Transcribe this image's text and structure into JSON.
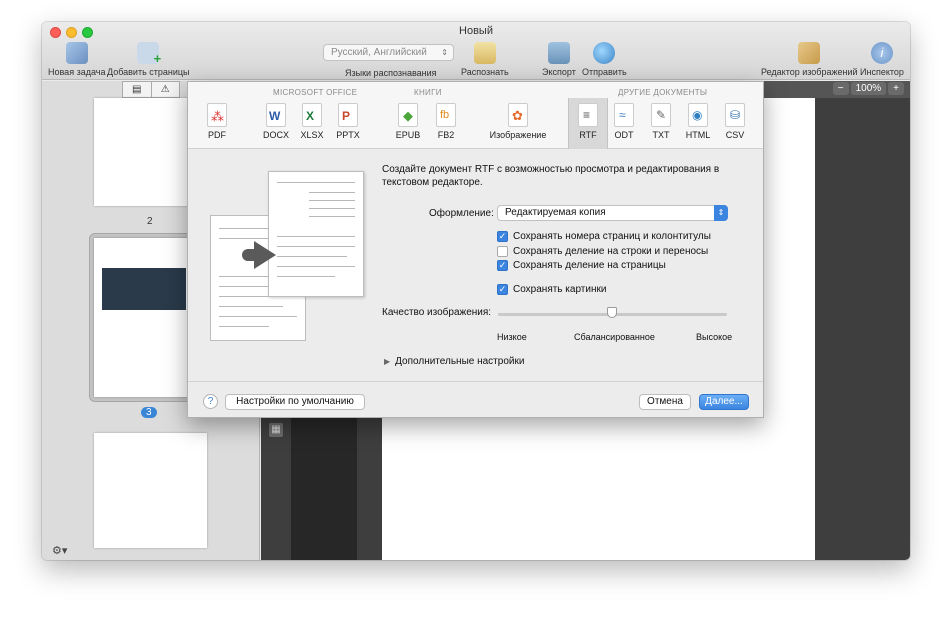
{
  "window": {
    "title": "Новый"
  },
  "toolbar": {
    "new_task": "Новая задача",
    "add_pages": "Добавить страницы",
    "languages_value": "Русский, Английский",
    "languages_caption": "Языки распознавания",
    "recognize": "Распознать",
    "export": "Экспорт",
    "send": "Отправить",
    "image_editor": "Редактор изображений",
    "inspector": "Инспектор"
  },
  "sidebar": {
    "pages": [
      {
        "number": "2"
      },
      {
        "number": "3",
        "selected": true
      }
    ]
  },
  "canvas": {
    "zoom": "100%",
    "zoom_out": "−",
    "zoom_in": "+"
  },
  "export_dialog": {
    "groups": {
      "office": "MICROSOFT OFFICE",
      "books": "КНИГИ",
      "other": "ДРУГИЕ ДОКУМЕНТЫ"
    },
    "formats": [
      "PDF",
      "DOCX",
      "XLSX",
      "PPTX",
      "EPUB",
      "FB2",
      "Изображение",
      "RTF",
      "ODT",
      "TXT",
      "HTML",
      "CSV"
    ],
    "selected_format": "RTF",
    "description": "Создайте документ RTF с возможностью просмотра и редактирования в текстовом редакторе.",
    "layout_label": "Оформление:",
    "layout_value": "Редактируемая копия",
    "options": [
      {
        "label": "Сохранять номера страниц и колонтитулы",
        "checked": true
      },
      {
        "label": "Сохранять деление на строки и переносы",
        "checked": false
      },
      {
        "label": "Сохранять деление на страницы",
        "checked": true
      },
      {
        "label": "Сохранять картинки",
        "checked": true
      }
    ],
    "quality_label": "Качество изображения:",
    "quality_levels": [
      "Низкое",
      "Сбалансированное",
      "Высокое"
    ],
    "quality_value": 0.5,
    "advanced": "Дополнительные настройки",
    "defaults_button": "Настройки по умолчанию",
    "cancel_button": "Отмена",
    "next_button": "Далее...",
    "help": "?"
  },
  "colors": {
    "accent": "#3b84e0",
    "selected_format_bg": "#d8d8d8"
  }
}
